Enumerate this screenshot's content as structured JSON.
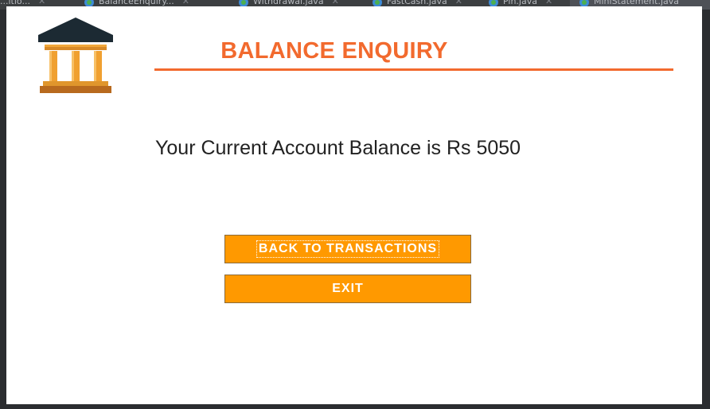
{
  "ide_tabs": [
    {
      "label": "...itio..."
    },
    {
      "label": "BalanceEnquiry..."
    },
    {
      "label": "Withdrawal.java"
    },
    {
      "label": "FastCash.java"
    },
    {
      "label": "Pin.java"
    },
    {
      "label": "MiniStatement.java"
    }
  ],
  "colors": {
    "accent": "#f26a2e",
    "button": "#ff9900",
    "logo_roof": "#1c2a33",
    "logo_columns": "#f0a030"
  },
  "logo": {
    "icon": "bank-building-icon"
  },
  "header": {
    "title": "BALANCE ENQUIRY"
  },
  "main": {
    "balance_message": "Your Current Account Balance is Rs 5050"
  },
  "buttons": {
    "back_label": "BACK TO TRANSACTIONS",
    "exit_label": "EXIT"
  }
}
